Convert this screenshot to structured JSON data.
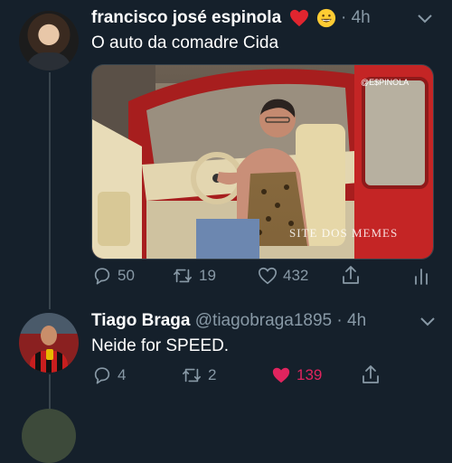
{
  "tweet1": {
    "display_name": "francisco josé espinola",
    "time": "· 4h",
    "text": "O auto da comadre Cida",
    "media_watermark_top": "@E$PINOLA",
    "media_watermark_bottom": "SITE DOS MEMES",
    "replies": "50",
    "retweets": "19",
    "likes": "432"
  },
  "tweet2": {
    "display_name": "Tiago Braga",
    "handle": "@tiagobraga1895",
    "time": "· 4h",
    "text": "Neide for SPEED.",
    "replies": "4",
    "retweets": "2",
    "likes": "139"
  },
  "colors": {
    "background": "#15202b",
    "muted": "#8899a6",
    "like_active": "#e0245e",
    "thread_line": "#38444d"
  }
}
